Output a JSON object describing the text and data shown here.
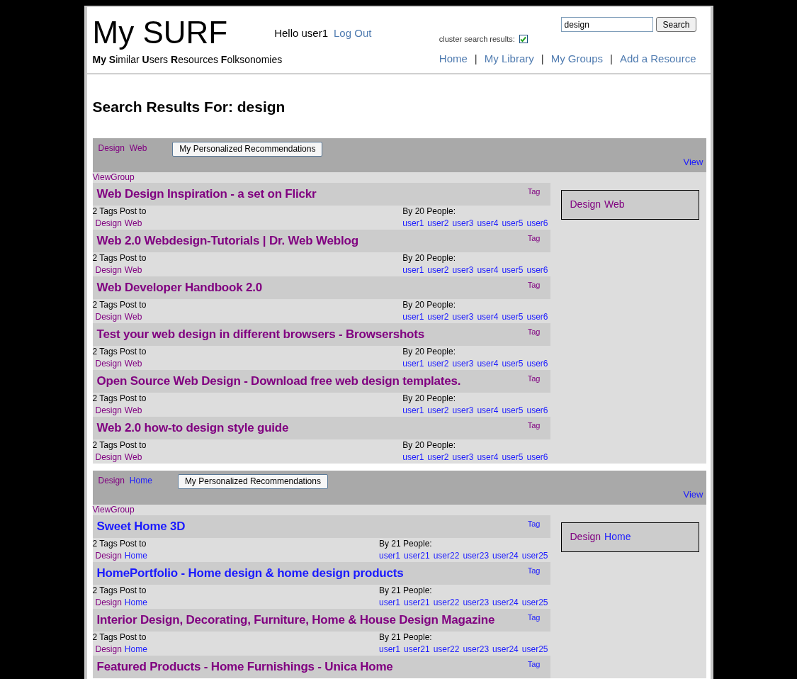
{
  "header": {
    "logo": "My SURF",
    "greeting": "Hello user1",
    "logout": "Log Out",
    "tagline": "**My** **S**imilar **U**sers **R**esources **F**olksonomies",
    "search": {
      "value": "design",
      "button": "Search"
    },
    "cluster": {
      "label": "cluster search results:",
      "checked": true
    },
    "nav": [
      "Home",
      "My Library",
      "My Groups",
      "Add a Resource"
    ],
    "nav_separator": "|"
  },
  "heading": "Search Results For: design",
  "groups": [
    {
      "tags": [
        {
          "text": "Design",
          "visited": true
        },
        {
          "text": "Web",
          "visited": true
        }
      ],
      "button": "My Personalized Recommendations",
      "view": "View",
      "viewgroup": "ViewGroup",
      "box_tags": [
        {
          "text": "Design",
          "visited": true
        },
        {
          "text": "Web",
          "visited": true
        }
      ],
      "items": [
        {
          "title": "Web Design Inspiration - a set on Flickr",
          "visited": true,
          "tag": {
            "text": "Tag",
            "visited": true
          },
          "tags_label": "2 Tags Post to",
          "people_label": "By 20 People:",
          "post_tags": [
            {
              "text": "Design",
              "visited": true
            },
            {
              "text": "Web",
              "visited": true
            }
          ],
          "users": [
            "user1",
            "user2",
            "user3",
            "user4",
            "user5",
            "user6"
          ]
        },
        {
          "title": "Web 2.0 Webdesign-Tutorials | Dr. Web Weblog",
          "visited": true,
          "tag": {
            "text": "Tag",
            "visited": true
          },
          "tags_label": "2 Tags Post to",
          "people_label": "By 20 People:",
          "post_tags": [
            {
              "text": "Design",
              "visited": true
            },
            {
              "text": "Web",
              "visited": true
            }
          ],
          "users": [
            "user1",
            "user2",
            "user3",
            "user4",
            "user5",
            "user6"
          ]
        },
        {
          "title": "Web Developer Handbook 2.0",
          "visited": true,
          "tag": {
            "text": "Tag",
            "visited": true
          },
          "tags_label": "2 Tags Post to",
          "people_label": "By 20 People:",
          "post_tags": [
            {
              "text": "Design",
              "visited": true
            },
            {
              "text": "Web",
              "visited": true
            }
          ],
          "users": [
            "user1",
            "user2",
            "user3",
            "user4",
            "user5",
            "user6"
          ]
        },
        {
          "title": "Test your web design in different browsers - Browsershots",
          "visited": true,
          "tag": {
            "text": "Tag",
            "visited": true
          },
          "tags_label": "2 Tags Post to",
          "people_label": "By 20 People:",
          "post_tags": [
            {
              "text": "Design",
              "visited": true
            },
            {
              "text": "Web",
              "visited": true
            }
          ],
          "users": [
            "user1",
            "user2",
            "user3",
            "user4",
            "user5",
            "user6"
          ]
        },
        {
          "title": "Open Source Web Design - Download free web design templates.",
          "visited": true,
          "tag": {
            "text": "Tag",
            "visited": true
          },
          "tags_label": "2 Tags Post to",
          "people_label": "By 20 People:",
          "post_tags": [
            {
              "text": "Design",
              "visited": true
            },
            {
              "text": "Web",
              "visited": true
            }
          ],
          "users": [
            "user1",
            "user2",
            "user3",
            "user4",
            "user5",
            "user6"
          ]
        },
        {
          "title": "Web 2.0 how-to design style guide",
          "visited": true,
          "tag": {
            "text": "Tag",
            "visited": true
          },
          "tags_label": "2 Tags Post to",
          "people_label": "By 20 People:",
          "post_tags": [
            {
              "text": "Design",
              "visited": true
            },
            {
              "text": "Web",
              "visited": true
            }
          ],
          "users": [
            "user1",
            "user2",
            "user3",
            "user4",
            "user5",
            "user6"
          ]
        }
      ]
    },
    {
      "tags": [
        {
          "text": "Design",
          "visited": true
        },
        {
          "text": "Home",
          "visited": false
        }
      ],
      "button": "My Personalized Recommendations",
      "view": "View",
      "viewgroup": "ViewGroup",
      "box_tags": [
        {
          "text": "Design",
          "visited": true
        },
        {
          "text": "Home",
          "visited": false
        }
      ],
      "items": [
        {
          "title": "Sweet Home 3D",
          "visited": false,
          "tag": {
            "text": "Tag",
            "visited": false
          },
          "tags_label": "2 Tags Post to",
          "people_label": "By 21 People:",
          "post_tags": [
            {
              "text": "Design",
              "visited": true
            },
            {
              "text": "Home",
              "visited": false
            }
          ],
          "users": [
            "user1",
            "user21",
            "user22",
            "user23",
            "user24",
            "user25"
          ]
        },
        {
          "title": "HomePortfolio - Home design & home design products",
          "visited": false,
          "tag": {
            "text": "Tag",
            "visited": false
          },
          "tags_label": "2 Tags Post to",
          "people_label": "By 21 People:",
          "post_tags": [
            {
              "text": "Design",
              "visited": true
            },
            {
              "text": "Home",
              "visited": false
            }
          ],
          "users": [
            "user1",
            "user21",
            "user22",
            "user23",
            "user24",
            "user25"
          ]
        },
        {
          "title": "Interior Design, Decorating, Furniture, Home & House Design Magazine",
          "visited": true,
          "tag": {
            "text": "Tag",
            "visited": false
          },
          "tags_label": "2 Tags Post to",
          "people_label": "By 21 People:",
          "post_tags": [
            {
              "text": "Design",
              "visited": true
            },
            {
              "text": "Home",
              "visited": false
            }
          ],
          "users": [
            "user1",
            "user21",
            "user22",
            "user23",
            "user24",
            "user25"
          ]
        },
        {
          "title": "Featured Products - Home Furnishings - Unica Home",
          "visited": true,
          "tag": {
            "text": "Tag",
            "visited": false
          }
        }
      ]
    }
  ]
}
